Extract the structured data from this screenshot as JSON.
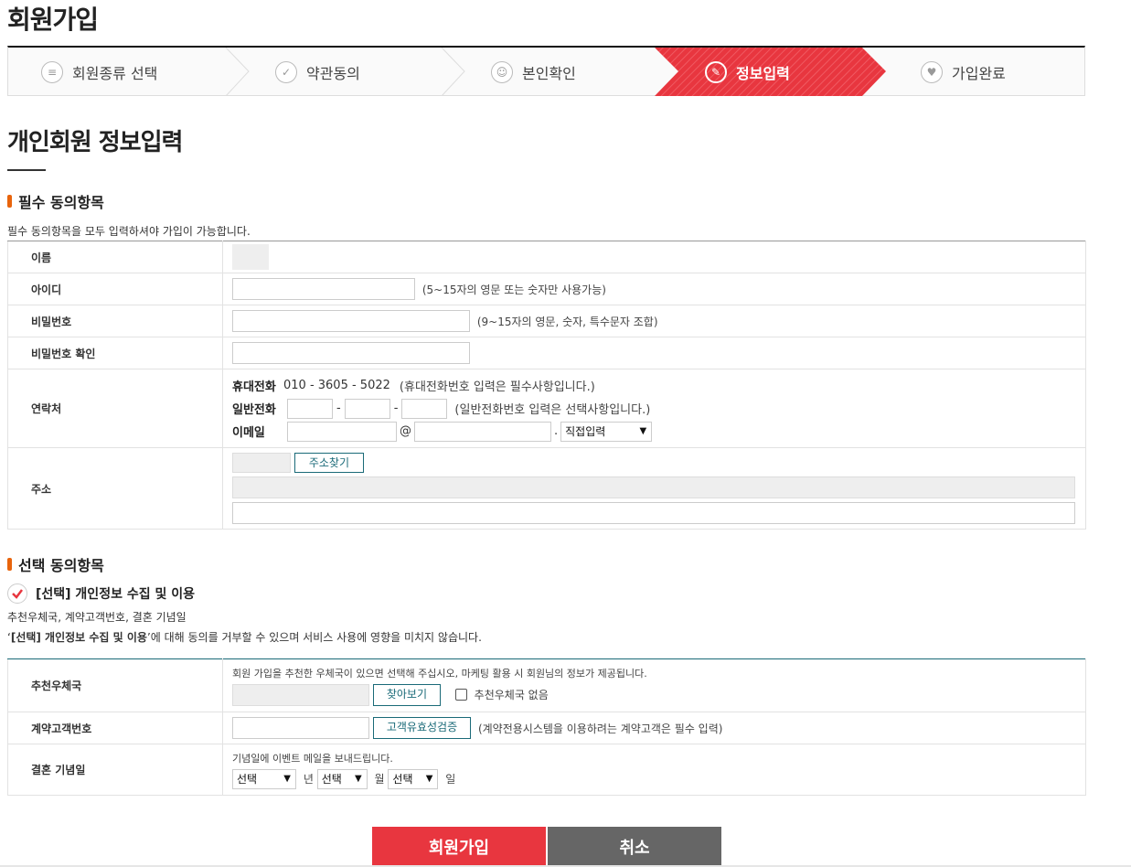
{
  "page": {
    "title": "회원가입"
  },
  "steps": [
    {
      "label": "회원종류 선택",
      "icon": "list-icon"
    },
    {
      "label": "약관동의",
      "icon": "check-icon"
    },
    {
      "label": "본인확인",
      "icon": "person-icon"
    },
    {
      "label": "정보입력",
      "icon": "pencil-icon",
      "active": true
    },
    {
      "label": "가입완료",
      "icon": "heart-icon"
    }
  ],
  "colors": {
    "accent": "#e8363f",
    "orange": "#e8640c",
    "teal": "#1a6a78",
    "cancel": "#666666"
  },
  "section": {
    "title": "개인회원 정보입력",
    "required_title": "필수 동의항목",
    "required_note": "필수 동의항목을 모두 입력하셔야 가입이 가능합니다."
  },
  "required": {
    "name_label": "이름",
    "id_label": "아이디",
    "id_hint": "(5~15자의 영문 또는 숫자만 사용가능)",
    "pw_label": "비밀번호",
    "pw_hint": "(9~15자의 영문, 숫자, 특수문자 조합)",
    "pw_confirm_label": "비밀번호 확인",
    "contact_label": "연락처",
    "mobile_label": "휴대전화",
    "mobile_value": "010 - 3605 - 5022",
    "mobile_hint": "(휴대전화번호 입력은 필수사항입니다.)",
    "phone_label": "일반전화",
    "phone_dash": "-",
    "phone_hint": "(일반전화번호 입력은 선택사항입니다.)",
    "email_label": "이메일",
    "email_at": "@",
    "email_dot": ".",
    "email_domain_select": "직접입력",
    "address_label": "주소",
    "address_button": "주소찾기"
  },
  "optional": {
    "title": "선택 동의항목",
    "consent_label": "[선택] 개인정보 수집 및 이용",
    "items_text": "추천우체국, 계약고객번호, 결혼 기념일",
    "notice_quote_open": "‘",
    "notice_bold": "[선택] 개인정보 수집 및 이용",
    "notice_rest": "’에 대해 동의를 거부할 수 있으며 서비스 사용에 영향을 미치지 않습니다.",
    "post_office_label": "추천우체국",
    "post_office_desc": "회원 가입을 추천한 우체국이 있으면 선택해 주십시오, 마케팅 활용 시 회원님의 정보가 제공됩니다.",
    "post_office_button": "찾아보기",
    "post_office_none": "추천우체국 없음",
    "contract_label": "계약고객번호",
    "contract_button": "고객유효성검증",
    "contract_hint": "(계약전용시스템을 이용하려는 계약고객은 필수 입력)",
    "anniv_label": "결혼 기념일",
    "anniv_desc": "기념일에 이벤트 메일을 보내드립니다.",
    "select_placeholder": "선택",
    "year_unit": "년",
    "month_unit": "월",
    "day_unit": "일"
  },
  "actions": {
    "submit": "회원가입",
    "cancel": "취소"
  }
}
